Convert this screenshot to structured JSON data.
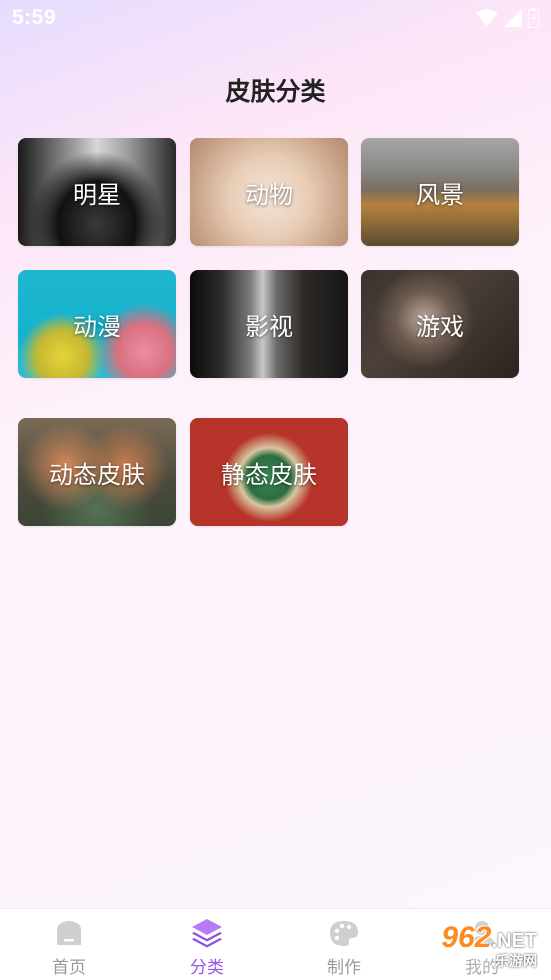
{
  "status_bar": {
    "time": "5:59"
  },
  "header": {
    "title": "皮肤分类"
  },
  "categories": [
    {
      "label": "明星"
    },
    {
      "label": "动物"
    },
    {
      "label": "风景"
    },
    {
      "label": "动漫"
    },
    {
      "label": "影视"
    },
    {
      "label": "游戏"
    },
    {
      "label": "动态皮肤"
    },
    {
      "label": "静态皮肤"
    }
  ],
  "tabbar": {
    "tabs": [
      {
        "label": "首页",
        "icon": "home-icon"
      },
      {
        "label": "分类",
        "icon": "layers-icon",
        "active": true
      },
      {
        "label": "制作",
        "icon": "palette-icon"
      },
      {
        "label": "我的",
        "icon": "user-icon"
      }
    ],
    "active_color": "#9a56e8",
    "inactive_color": "#9a9a9a"
  },
  "watermark": {
    "brand": "962",
    "suffix": ".NET",
    "subtitle": "乐游网"
  }
}
